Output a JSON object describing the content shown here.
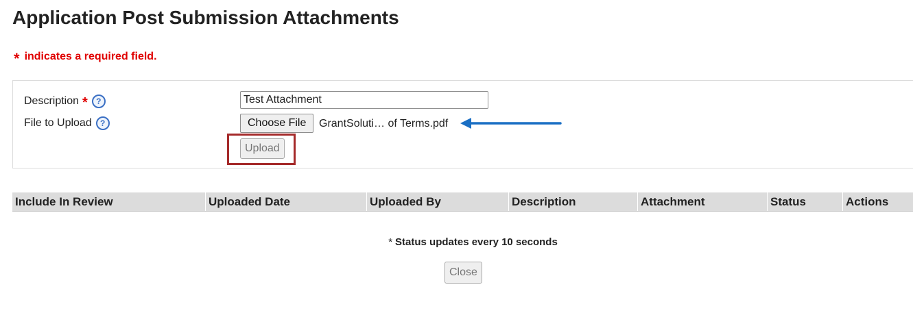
{
  "page": {
    "title": "Application Post Submission Attachments",
    "required_symbol": "*",
    "required_note": "indicates a required field."
  },
  "form": {
    "description_label": "Description",
    "description_value": "Test Attachment",
    "file_label": "File to Upload",
    "choose_file_label": "Choose File",
    "chosen_file_name": "GrantSoluti… of Terms.pdf",
    "upload_label": "Upload",
    "help_icon_glyph": "?"
  },
  "table": {
    "columns": [
      "Include In Review",
      "Uploaded Date",
      "Uploaded By",
      "Description",
      "Attachment",
      "Status",
      "Actions"
    ]
  },
  "footer": {
    "status_asterisk": "*",
    "status_note": "Status updates every 10 seconds",
    "close_label": "Close"
  },
  "colors": {
    "required": "#e00000",
    "help_icon": "#3a6fc4",
    "arrow": "#1a6fc4",
    "highlight_box": "#a52a2a",
    "table_header_bg": "#dcdcdc"
  }
}
